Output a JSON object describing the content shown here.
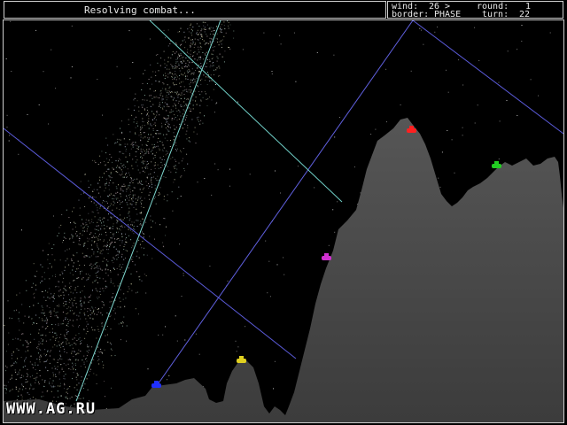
{
  "status": {
    "message": "Resolving combat..."
  },
  "stats": {
    "wind_label": "wind:",
    "wind_value": "26 >",
    "round_label": "round:",
    "round_value": "1",
    "border_label": "border:",
    "border_value": "PHASE",
    "turn_label": "turn:",
    "turn_value": "22"
  },
  "watermark": "WWW.AG.RU",
  "colors": {
    "terrain": "#4a4a4a",
    "tank_red": "#ff2020",
    "tank_green": "#22cc22",
    "tank_magenta": "#d030d0",
    "tank_yellow": "#e0d020",
    "tank_blue": "#2030ff",
    "trail_blue": "#5a5ad8",
    "trail_cyan": "#7fd8d0"
  },
  "tanks": [
    {
      "name": "red-tank",
      "color": "#ff2020"
    },
    {
      "name": "green-tank",
      "color": "#22cc22"
    },
    {
      "name": "magenta-tank",
      "color": "#d030d0"
    },
    {
      "name": "yellow-tank",
      "color": "#e0d020"
    },
    {
      "name": "blue-tank",
      "color": "#2030ff"
    }
  ]
}
